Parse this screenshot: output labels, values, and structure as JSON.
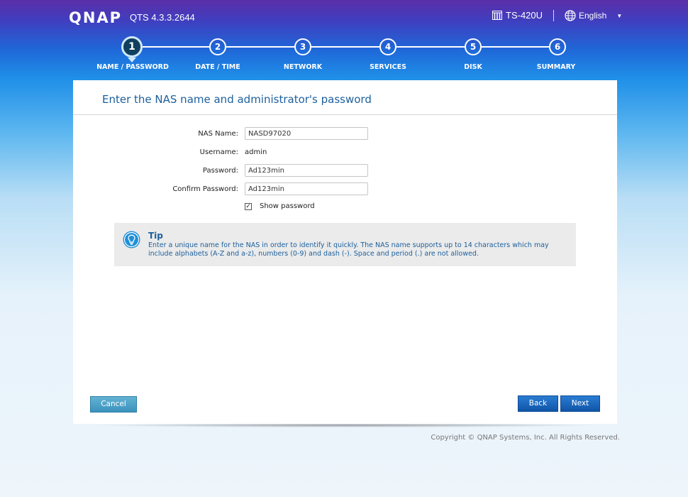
{
  "header": {
    "logo": "QNAP",
    "version": "QTS 4.3.3.2644",
    "device": "TS-420U",
    "language": "English"
  },
  "steps": [
    {
      "number": "1",
      "label": "NAME / PASSWORD",
      "active": true
    },
    {
      "number": "2",
      "label": "DATE / TIME",
      "active": false
    },
    {
      "number": "3",
      "label": "NETWORK",
      "active": false
    },
    {
      "number": "4",
      "label": "SERVICES",
      "active": false
    },
    {
      "number": "5",
      "label": "DISK",
      "active": false
    },
    {
      "number": "6",
      "label": "SUMMARY",
      "active": false
    }
  ],
  "panel": {
    "title": "Enter the NAS name and administrator's password"
  },
  "form": {
    "nas_name_label": "NAS Name:",
    "nas_name_value": "NASD97020",
    "username_label": "Username:",
    "username_value": "admin",
    "password_label": "Password:",
    "password_value": "Ad123min",
    "confirm_label": "Confirm Password:",
    "confirm_value": "Ad123min",
    "show_password_label": "Show password",
    "show_password_checked": true
  },
  "tip": {
    "title": "Tip",
    "text": "Enter a unique name for the NAS in order to identify it quickly. The NAS name supports up to 14 characters which may include alphabets (A-Z and a-z), numbers (0-9) and dash (-). Space and period (.) are not allowed."
  },
  "buttons": {
    "cancel": "Cancel",
    "back": "Back",
    "next": "Next"
  },
  "footer": {
    "copyright": "Copyright © QNAP Systems, Inc. All Rights Reserved."
  },
  "colors": {
    "accent": "#1c5f9c",
    "active_step": "#10405e",
    "button_primary": "#0f55a8",
    "button_secondary": "#3b92bd"
  }
}
